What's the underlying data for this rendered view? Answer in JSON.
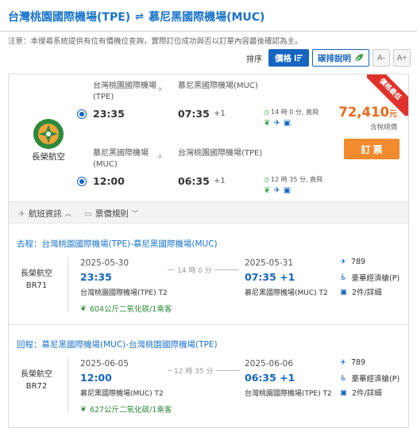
{
  "header": {
    "origin": "台灣桃園國際機場(TPE)",
    "destination": "慕尼黑國際機場(MUC)"
  },
  "notice": "注意：本搜尋系統提供有位有價機位查詢，實際訂位成功與否以訂單內容最後確認為主。",
  "toolbar": {
    "sort_label": "排序",
    "price_label": "價格",
    "carbon_label": "碳排說明",
    "font_minus": "A-",
    "font_plus": "A+"
  },
  "result": {
    "airline": "長榮航空",
    "badge": "價格最低",
    "price": "72,410",
    "currency": "元",
    "tax_note": "含稅總價",
    "book_label": "訂 票",
    "outbound": {
      "from": "台灣桃園國際機場(TPE)",
      "to": "慕尼黑國際機場(MUC)",
      "dep_time": "23:35",
      "arr_time": "07:35",
      "day_offset": "+1",
      "duration": "14 時 0 分, 直飛"
    },
    "inbound": {
      "from": "慕尼黑國際機場(MUC)",
      "to": "台灣桃園國際機場(TPE)",
      "dep_time": "12:00",
      "arr_time": "06:35",
      "day_offset": "+1",
      "duration": "12 時 35 分, 直飛"
    }
  },
  "tabs": {
    "flight_info": "航班資訊",
    "fare_rules": "票價規則"
  },
  "segments": [
    {
      "title": "去程：台灣桃園國際機場(TPE)-慕尼黑國際機場(MUC)",
      "airline": "長榮航空",
      "flight_no": "BR71",
      "dep_date": "2025-05-30",
      "dep_time": "23:35",
      "dep_airport": "台灣桃園國際機場(TPE) T2",
      "duration": "14 時 0 分",
      "arr_date": "2025-05-31",
      "arr_time": "07:35 +1",
      "arr_airport": "慕尼黑國際機場(MUC) T2",
      "aircraft": "789",
      "cabin": "豪華經濟艙(P)",
      "baggage": "2件/詳細",
      "carbon": "604公斤二氧化碳/1乘客"
    },
    {
      "title": "回程：慕尼黑國際機場(MUC)-台灣桃園國際機場(TPE)",
      "airline": "長榮航空",
      "flight_no": "BR72",
      "dep_date": "2025-06-05",
      "dep_time": "12:00",
      "dep_airport": "慕尼黑國際機場(MUC) T2",
      "duration": "12 時 35 分",
      "arr_date": "2025-06-06",
      "arr_time": "06:35 +1",
      "arr_airport": "台灣桃園國際機場(TPE) T2",
      "aircraft": "789",
      "cabin": "豪華經濟艙(P)",
      "baggage": "2件/詳細",
      "carbon": "627公斤二氧化碳/1乘客"
    }
  ],
  "colors": {
    "primary": "#1565c0",
    "accent": "#f28a2e",
    "badge": "#e0322c",
    "carbon": "#2e8b3a"
  }
}
